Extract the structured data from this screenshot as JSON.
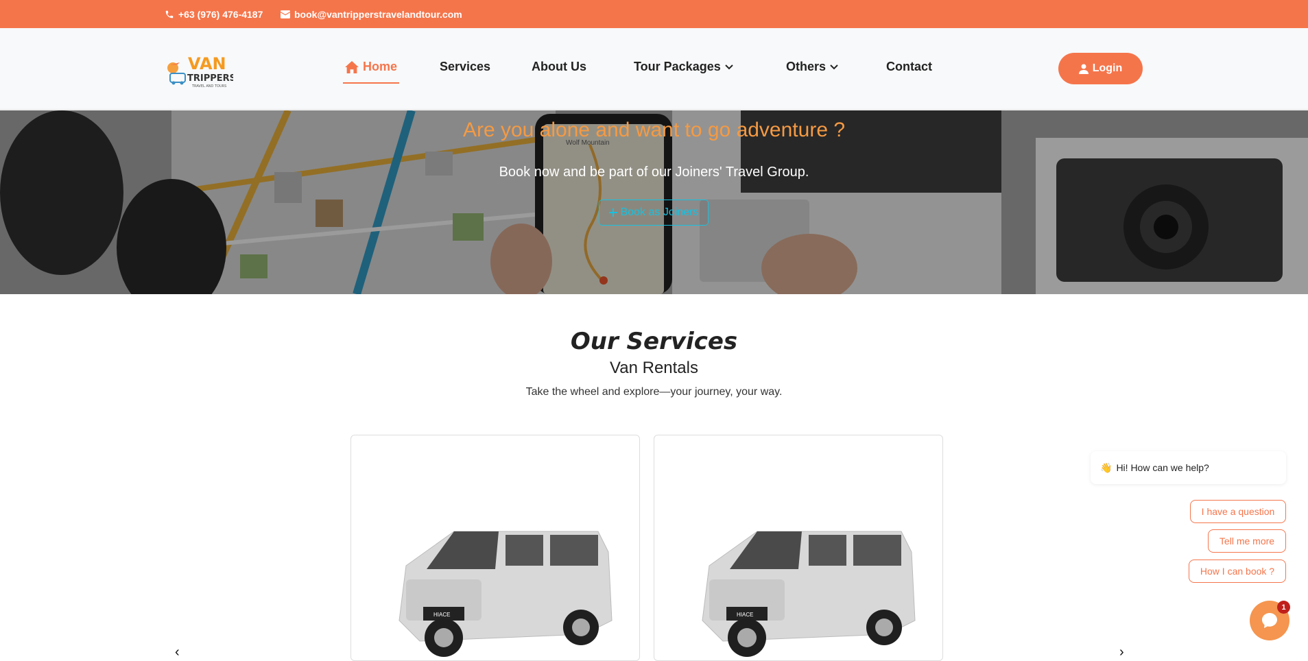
{
  "topbar": {
    "phone": "+63 (976) 476-4187",
    "email": "book@vantripperstravelandtour.com"
  },
  "brand": {
    "name_line1": "VAN",
    "name_line2": "TRIPPERS",
    "tagline": "TRAVEL AND TOURS"
  },
  "nav": {
    "items": [
      {
        "label": "Home"
      },
      {
        "label": "Services"
      },
      {
        "label": "About Us"
      },
      {
        "label": "Tour Packages"
      },
      {
        "label": "Others"
      },
      {
        "label": "Contact"
      }
    ],
    "login_label": "Login"
  },
  "hero": {
    "title": "Are you alone and want to go adventure ?",
    "subtitle": "Book now and be part of our Joiners' Travel Group.",
    "button_label": "Book as Joiners",
    "phone_map_label": "Wolf Mountain"
  },
  "services": {
    "title": "Our Services",
    "subtitle": "Van Rentals",
    "description": "Take the wheel and explore—your journey, your way."
  },
  "cards": [
    {
      "badge": "HIACE"
    },
    {
      "badge": "HIACE"
    }
  ],
  "chat": {
    "greeting_emoji": "👋",
    "greeting": "Hi! How can we help?",
    "options": [
      "I have a question",
      "Tell me more",
      "How I can book ?"
    ],
    "badge_count": "1"
  },
  "colors": {
    "brand_orange": "#f5754b",
    "hero_title": "#f59a43",
    "joiners_cyan": "#17c1e0"
  }
}
